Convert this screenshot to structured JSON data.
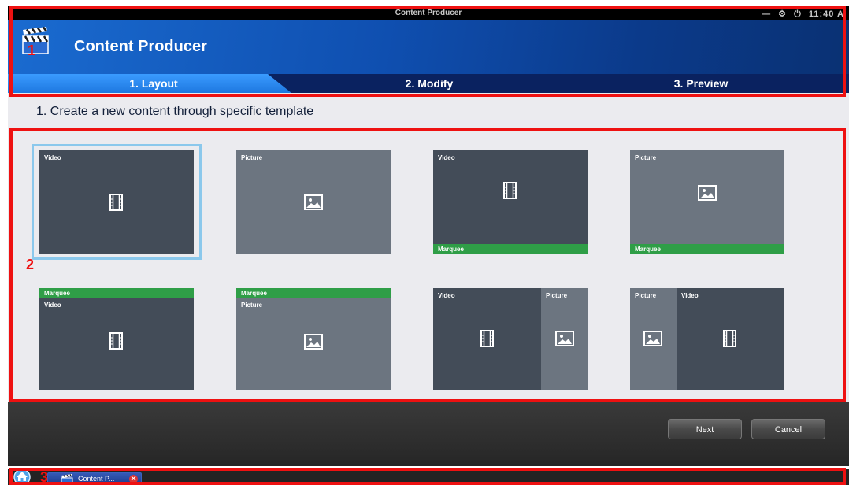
{
  "window": {
    "title": "Content Producer",
    "controls": [
      "—",
      "⚙",
      "⏻",
      "11:40 A"
    ]
  },
  "header": {
    "app_name": "Content Producer",
    "app_icon": "clapperboard-icon"
  },
  "steps": [
    {
      "label": "1. Layout",
      "active": true
    },
    {
      "label": "2. Modify",
      "active": false
    },
    {
      "label": "3. Preview",
      "active": false
    }
  ],
  "instruction": "1. Create a new content through specific template",
  "templates": {
    "video": "Video",
    "picture": "Picture",
    "marquee": "Marquee",
    "selected_index": 0
  },
  "actions": {
    "next": "Next",
    "cancel": "Cancel"
  },
  "taskbar": {
    "home_icon": "home-icon",
    "task_label": "Content P..."
  },
  "annotations": {
    "one": "1",
    "two": "2",
    "three": "3",
    "color": "#ee1111"
  },
  "colors": {
    "header": "#1a6bd0",
    "active_tab": "#2a8af0",
    "video_pane": "#434c58",
    "picture_pane": "#6c7580",
    "marquee": "#2f9e47",
    "selection": "#8bc8ec"
  }
}
